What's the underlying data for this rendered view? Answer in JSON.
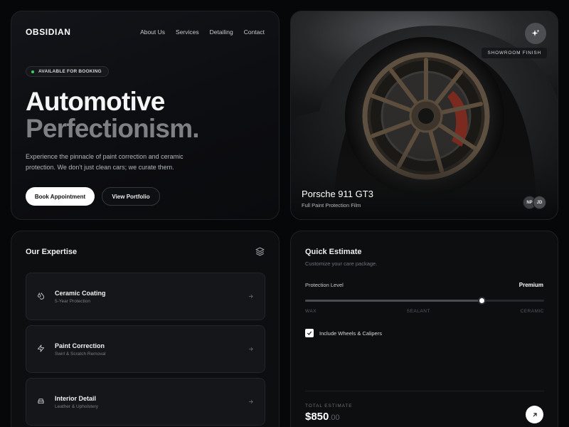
{
  "brand": "OBSIDIAN",
  "nav": [
    "About Us",
    "Services",
    "Detailing",
    "Contact"
  ],
  "hero": {
    "badge": "AVAILABLE FOR BOOKING",
    "title_line1": "Automotive",
    "title_line2": "Perfectionism.",
    "description": "Experience the pinnacle of paint correction and ceramic protection. We don't just clean cars; we curate them.",
    "primary_button": "Book Appointment",
    "secondary_button": "View Portfolio"
  },
  "showcase": {
    "tag": "SHOWROOM FINISH",
    "car_name": "Porsche 911 GT3",
    "car_subtitle": "Full Paint Protection Film",
    "avatars": [
      "NP",
      "JD"
    ],
    "icon": "sparkle-icon"
  },
  "expertise": {
    "title": "Our Expertise",
    "icon": "layers-icon",
    "services": [
      {
        "title": "Ceramic Coating",
        "subtitle": "5-Year Protection",
        "icon": "droplets-icon"
      },
      {
        "title": "Paint Correction",
        "subtitle": "Swirl & Scratch Removal",
        "icon": "zap-icon"
      },
      {
        "title": "Interior Detail",
        "subtitle": "Leather & Upholstery",
        "icon": "car-seat-icon"
      }
    ]
  },
  "estimate": {
    "title": "Quick Estimate",
    "subtitle": "Customize your care package.",
    "level_label": "Protection Level",
    "level_value": "Premium",
    "slider_position": 0.74,
    "ticks": [
      "WAX",
      "SEALANT",
      "CERAMIC"
    ],
    "checkbox_label": "Include Wheels & Calipers",
    "checkbox_checked": true,
    "total_label": "TOTAL ESTIMATE",
    "total_dollars": "$850",
    "total_cents": ".00"
  },
  "colors": {
    "background": "#060708",
    "accent_green": "#3ecf6e",
    "muted_text": "#7e8086"
  }
}
